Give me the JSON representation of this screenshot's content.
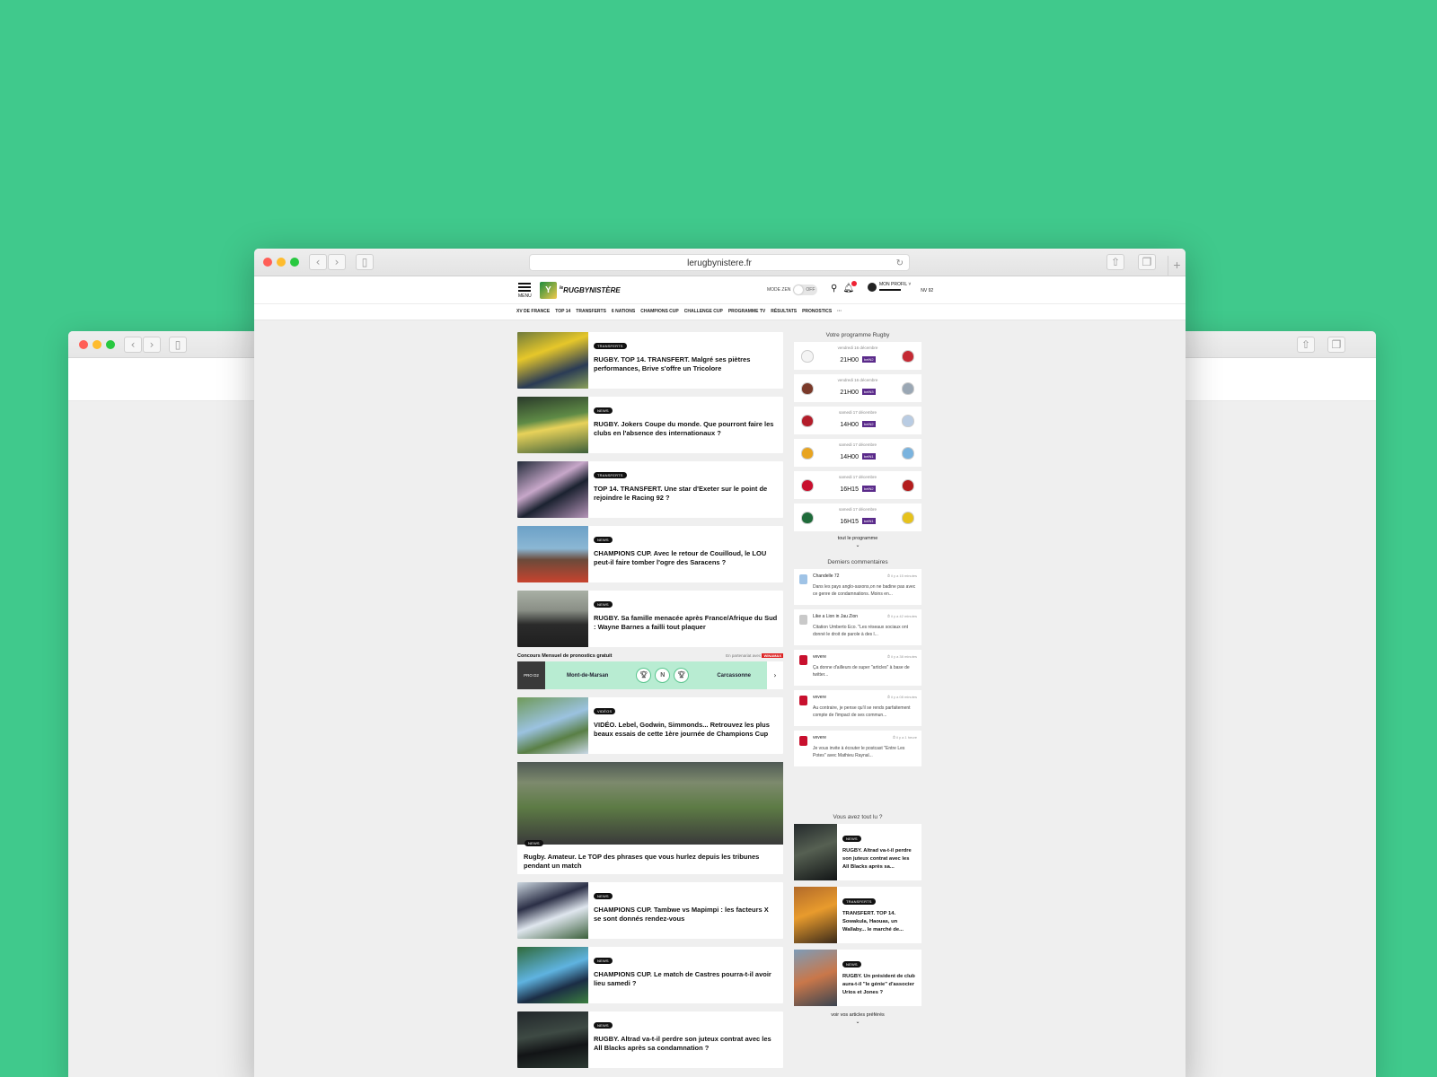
{
  "browser": {
    "url": "lerugbynistere.fr"
  },
  "site": {
    "menu_label": "MENU",
    "logo_prefix": "le",
    "logo_text": "RUGBYNISTÈRE",
    "zen_label": "MODE ZEN",
    "zen_state": "OFF",
    "profile_label": "MON PROFIL ˅",
    "profile_sub": "NV 92",
    "nav": [
      "XV DE FRANCE",
      "TOP 14",
      "TRANSFERTS",
      "6 NATIONS",
      "CHAMPIONS CUP",
      "CHALLENGE CUP",
      "PROGRAMME TV",
      "RÉSULTATS",
      "PRONOSTICS",
      "···"
    ]
  },
  "feed": {
    "articles_top": [
      {
        "badge": "TRANSFERTS",
        "title": "RUGBY. TOP 14. TRANSFERT. Malgré ses piètres performances, Brive s'offre un Tricolore"
      },
      {
        "badge": "NEWS",
        "title": "RUGBY. Jokers Coupe du monde. Que pourront faire les clubs en l'absence des internationaux ?"
      },
      {
        "badge": "TRANSFERTS",
        "title": "TOP 14. TRANSFERT. Une star d'Exeter sur le point de rejoindre le Racing 92 ?"
      },
      {
        "badge": "NEWS",
        "title": "CHAMPIONS CUP. Avec le retour de Couilloud, le LOU peut-il faire tomber l'ogre des Saracens ?"
      },
      {
        "badge": "NEWS",
        "title": "RUGBY. Sa famille menacée après France/Afrique du Sud : Wayne Barnes a failli tout plaquer"
      }
    ],
    "contest": {
      "title": "Concours Mensuel de pronostics gratuit",
      "partner": "En partenariat avec",
      "partner_badge": "WINAMAX",
      "league": "PRO D2",
      "home": "Mont-de-Marsan",
      "draw": "N",
      "away": "Carcassonne"
    },
    "video": {
      "badge": "VIDÉOS",
      "title": "VIDÉO. Lebel, Godwin, Simmonds... Retrouvez les plus beaux essais de cette 1ère journée de Champions Cup"
    },
    "big": {
      "badge": "NEWS",
      "title": "Rugby. Amateur. Le TOP des phrases que vous hurlez depuis les tribunes pendant un match"
    },
    "articles_bottom": [
      {
        "badge": "NEWS",
        "title": "CHAMPIONS CUP. Tambwe vs Mapimpi : les facteurs X se sont donnés rendez-vous"
      },
      {
        "badge": "NEWS",
        "title": "CHAMPIONS CUP. Le match de Castres pourra-t-il avoir lieu samedi ?"
      },
      {
        "badge": "NEWS",
        "title": "RUGBY. Altrad va-t-il perdre son juteux contrat avec les All Blacks après sa condamnation ?"
      }
    ]
  },
  "sidebar": {
    "program_title": "Votre programme Rugby",
    "matches": [
      {
        "date": "vendredi 16 décembre",
        "time": "21H00",
        "channel": "beIN2",
        "home_color": "#f4f4f4",
        "away_color": "#c42a34"
      },
      {
        "date": "vendredi 16 décembre",
        "time": "21H00",
        "channel": "beIN3",
        "home_color": "#7a3a2a",
        "away_color": "#9aa7b4"
      },
      {
        "date": "samedi 17 décembre",
        "time": "14H00",
        "channel": "beIN2",
        "home_color": "#b31d2a",
        "away_color": "#b9cce3"
      },
      {
        "date": "samedi 17 décembre",
        "time": "14H00",
        "channel": "beIN1",
        "home_color": "#e8a420",
        "away_color": "#7ab3de"
      },
      {
        "date": "samedi 17 décembre",
        "time": "16H15",
        "channel": "beIN2",
        "home_color": "#c8102e",
        "away_color": "#b31d1d"
      },
      {
        "date": "samedi 17 décembre",
        "time": "16H15",
        "channel": "beIN1",
        "home_color": "#1f6b3a",
        "away_color": "#e6c21c"
      }
    ],
    "program_more": "tout le programme",
    "comments_title": "Derniers commentaires",
    "comments": [
      {
        "user": "Chandelle 72",
        "ago": "il y a 15 minutes",
        "text": "Dans les pays anglo-saxons,on ne badine pas avec ce genre de condamnations. Moins en...",
        "color": "#9fc3e6"
      },
      {
        "user": "Like a Lion in Jau Zion",
        "ago": "il y a 42 minutes",
        "text": "Citation Umberto Eco. \"Les réseaux sociaux ont donné le droit de parole à des l...",
        "color": "#c9c9c9"
      },
      {
        "user": "vevere",
        "ago": "il y a 38 minutes",
        "text": "Ça donne d'ailleurs de super \"articles\" à base de twitter...",
        "color": "#c8102e"
      },
      {
        "user": "vevere",
        "ago": "il y a 08 minutes",
        "text": "Au contraire, je pense qu'il se rends parfaitement compte de l'impact de ses commun...",
        "color": "#c8102e"
      },
      {
        "user": "vevere",
        "ago": "il y a 1 heure",
        "text": "Je vous invite à écouter le postcast \"Entre Les Potes\" avec Mathieu Raynal...",
        "color": "#c8102e"
      }
    ],
    "read_title": "Vous avez tout lu ?",
    "read": [
      {
        "badge": "NEWS",
        "title": "RUGBY. Altrad va-t-il perdre son juteux contrat avec les All Blacks après sa..."
      },
      {
        "badge": "TRANSFERTS",
        "title": "TRANSFERT. TOP 14. Sowakula, Haouas, un Wallaby... le marché de..."
      },
      {
        "badge": "NEWS",
        "title": "RUGBY. Un président de club aura-t-il \"le génie\" d'associer Urios et Jones ?"
      }
    ],
    "read_more": "voir vos articles préférés"
  }
}
